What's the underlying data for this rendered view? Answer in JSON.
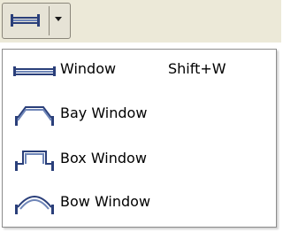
{
  "menu": {
    "items": [
      {
        "label": "Window",
        "shortcut": "Shift+W",
        "icon": "window-icon"
      },
      {
        "label": "Bay Window",
        "shortcut": "",
        "icon": "bay-window-icon"
      },
      {
        "label": "Box Window",
        "shortcut": "",
        "icon": "box-window-icon"
      },
      {
        "label": "Bow Window",
        "shortcut": "",
        "icon": "bow-window-icon"
      }
    ]
  },
  "toolbar": {
    "button_icon": "window-icon",
    "dropdown_icon": "chevron-down-icon"
  },
  "colors": {
    "toolbar_bg": "#ece9d8",
    "icon_blue": "#2a3f7a",
    "menu_border": "#8c8c8c"
  }
}
